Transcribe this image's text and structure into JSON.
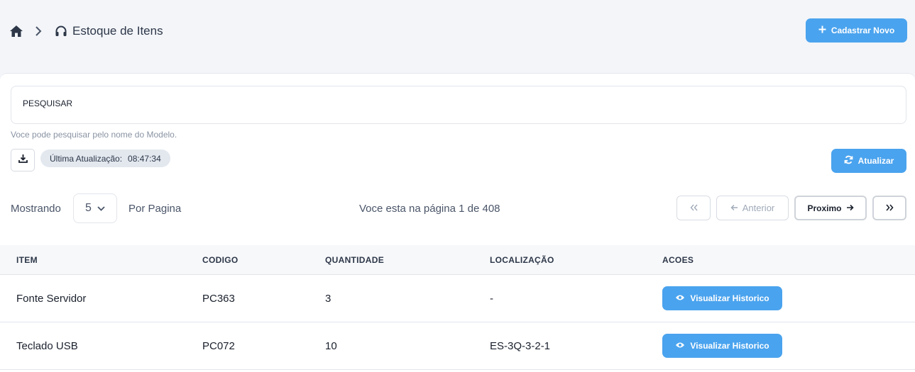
{
  "breadcrumb": {
    "home_icon": "home-icon",
    "separator_icon": "chevron-right-icon",
    "section_icon": "headphones-icon",
    "title": "Estoque de Itens"
  },
  "header": {
    "new_button_label": "Cadastrar Novo",
    "new_button_icon": "plus-icon"
  },
  "search": {
    "label": "PESQUISAR",
    "hint": "Voce pode pesquisar pelo nome do Modelo."
  },
  "toolbar": {
    "download_icon": "download-icon",
    "last_update_label": "Última Atualização:",
    "last_update_time": "08:47:34",
    "refresh_label": "Atualizar",
    "refresh_icon": "refresh-icon"
  },
  "pagination": {
    "showing_label": "Mostrando",
    "per_page_value": "5",
    "per_page_label": "Por Pagina",
    "page_info": "Voce esta na página 1 de 408",
    "first_icon": "double-chevron-left-icon",
    "prev_label": "Anterior",
    "next_label": "Proximo",
    "last_icon": "double-chevron-right-icon"
  },
  "table": {
    "columns": [
      "ITEM",
      "CODIGO",
      "QUANTIDADE",
      "LOCALIZAÇÃO",
      "ACOES"
    ],
    "rows": [
      {
        "item": "Fonte Servidor",
        "codigo": "PC363",
        "quantidade": "3",
        "localizacao": "-",
        "action": "Visualizar Historico"
      },
      {
        "item": "Teclado USB",
        "codigo": "PC072",
        "quantidade": "10",
        "localizacao": "ES-3Q-3-2-1",
        "action": "Visualizar Historico"
      }
    ]
  },
  "colors": {
    "primary": "#4aa3ee",
    "page_bg": "#f3f5f9",
    "badge_bg": "#e3e8ef"
  }
}
